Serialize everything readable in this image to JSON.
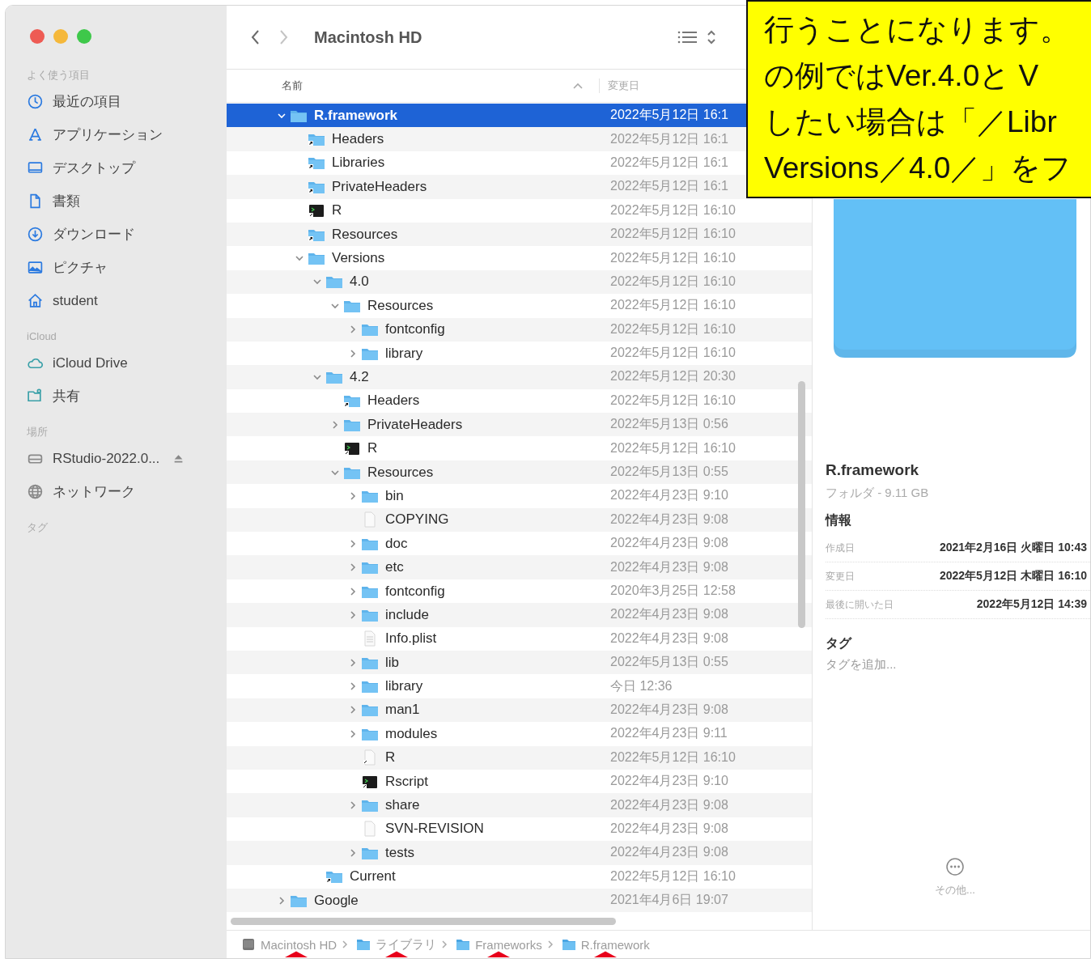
{
  "window": {
    "buttons": [
      {
        "color": "#ee5b54"
      },
      {
        "color": "#f5b83b"
      },
      {
        "color": "#3ec84a"
      }
    ]
  },
  "sidebar": {
    "sections": [
      {
        "title": "よく使う項目",
        "items": [
          {
            "label": "最近の項目",
            "kind": "recent"
          },
          {
            "label": "アプリケーション",
            "kind": "apps"
          },
          {
            "label": "デスクトップ",
            "kind": "desktop"
          },
          {
            "label": "書類",
            "kind": "documents"
          },
          {
            "label": "ダウンロード",
            "kind": "downloads"
          },
          {
            "label": "ピクチャ",
            "kind": "pictures"
          },
          {
            "label": "student",
            "kind": "home"
          }
        ]
      },
      {
        "title": "iCloud",
        "items": [
          {
            "label": "iCloud Drive",
            "kind": "cloud"
          },
          {
            "label": "共有",
            "kind": "shared"
          }
        ]
      },
      {
        "title": "場所",
        "items": [
          {
            "label": "RStudio-2022.0...",
            "kind": "volume"
          },
          {
            "label": "ネットワーク",
            "kind": "network"
          }
        ]
      },
      {
        "title": "タグ"
      }
    ]
  },
  "toolbar": {
    "nav": [
      {
        "kind": "back",
        "disabled": false
      },
      {
        "kind": "forward",
        "disabled": true
      }
    ],
    "title": "Macintosh HD"
  },
  "list": {
    "columns": [
      {
        "label": "名前",
        "sorted": true
      },
      {
        "label": "変更日",
        "sorted": false
      }
    ],
    "rows": [
      {
        "name": "R.framework",
        "date": "2022年5月12日 16:1",
        "kind": "folder",
        "expanded": true,
        "selected": true,
        "children": [
          {
            "name": "Headers",
            "date": "2022年5月12日 16:1",
            "kind": "alias",
            "selected": false
          },
          {
            "name": "Libraries",
            "date": "2022年5月12日 16:1",
            "kind": "alias",
            "selected": false
          },
          {
            "name": "PrivateHeaders",
            "date": "2022年5月12日 16:1",
            "kind": "alias",
            "selected": false
          },
          {
            "name": "R",
            "date": "2022年5月12日 16:10",
            "kind": "exec",
            "selected": false
          },
          {
            "name": "Resources",
            "date": "2022年5月12日 16:10",
            "kind": "alias",
            "selected": false
          },
          {
            "name": "Versions",
            "date": "2022年5月12日 16:10",
            "kind": "folder",
            "expanded": true,
            "selected": false,
            "children": [
              {
                "name": "4.0",
                "date": "2022年5月12日 16:10",
                "kind": "folder",
                "expanded": true,
                "selected": false,
                "children": [
                  {
                    "name": "Resources",
                    "date": "2022年5月12日 16:10",
                    "kind": "folder",
                    "expanded": true,
                    "selected": false,
                    "children": [
                      {
                        "name": "fontconfig",
                        "date": "2022年5月12日 16:10",
                        "kind": "folder",
                        "expanded": false,
                        "selected": false
                      },
                      {
                        "name": "library",
                        "date": "2022年5月12日 16:10",
                        "kind": "folder",
                        "expanded": false,
                        "selected": false
                      }
                    ]
                  }
                ]
              },
              {
                "name": "4.2",
                "date": "2022年5月12日 20:30",
                "kind": "folder",
                "expanded": true,
                "selected": false,
                "children": [
                  {
                    "name": "Headers",
                    "date": "2022年5月12日 16:10",
                    "kind": "alias",
                    "selected": false
                  },
                  {
                    "name": "PrivateHeaders",
                    "date": "2022年5月13日 0:56",
                    "kind": "folder",
                    "expanded": false,
                    "selected": false
                  },
                  {
                    "name": "R",
                    "date": "2022年5月12日 16:10",
                    "kind": "exec",
                    "selected": false
                  },
                  {
                    "name": "Resources",
                    "date": "2022年5月13日 0:55",
                    "kind": "folder",
                    "expanded": true,
                    "selected": false,
                    "children": [
                      {
                        "name": "bin",
                        "date": "2022年4月23日 9:10",
                        "kind": "folder",
                        "expanded": false,
                        "selected": false
                      },
                      {
                        "name": "COPYING",
                        "date": "2022年4月23日 9:08",
                        "kind": "doc",
                        "selected": false
                      },
                      {
                        "name": "doc",
                        "date": "2022年4月23日 9:08",
                        "kind": "folder",
                        "expanded": false,
                        "selected": false
                      },
                      {
                        "name": "etc",
                        "date": "2022年4月23日 9:08",
                        "kind": "folder",
                        "expanded": false,
                        "selected": false
                      },
                      {
                        "name": "fontconfig",
                        "date": "2020年3月25日 12:58",
                        "kind": "folder",
                        "expanded": false,
                        "selected": false
                      },
                      {
                        "name": "include",
                        "date": "2022年4月23日 9:08",
                        "kind": "folder",
                        "expanded": false,
                        "selected": false
                      },
                      {
                        "name": "Info.plist",
                        "date": "2022年4月23日 9:08",
                        "kind": "plist",
                        "selected": false
                      },
                      {
                        "name": "lib",
                        "date": "2022年5月13日 0:55",
                        "kind": "folder",
                        "expanded": false,
                        "selected": false
                      },
                      {
                        "name": "library",
                        "date": "今日 12:36",
                        "kind": "folder",
                        "expanded": false,
                        "selected": false
                      },
                      {
                        "name": "man1",
                        "date": "2022年4月23日 9:08",
                        "kind": "folder",
                        "expanded": false,
                        "selected": false
                      },
                      {
                        "name": "modules",
                        "date": "2022年4月23日 9:11",
                        "kind": "folder",
                        "expanded": false,
                        "selected": false
                      },
                      {
                        "name": "R",
                        "date": "2022年5月12日 16:10",
                        "kind": "aliasfile",
                        "selected": false
                      },
                      {
                        "name": "Rscript",
                        "date": "2022年4月23日 9:10",
                        "kind": "exec",
                        "selected": false
                      },
                      {
                        "name": "share",
                        "date": "2022年4月23日 9:08",
                        "kind": "folder",
                        "expanded": false,
                        "selected": false
                      },
                      {
                        "name": "SVN-REVISION",
                        "date": "2022年4月23日 9:08",
                        "kind": "doc",
                        "selected": false
                      },
                      {
                        "name": "tests",
                        "date": "2022年4月23日 9:08",
                        "kind": "folder",
                        "expanded": false,
                        "selected": false
                      }
                    ]
                  }
                ]
              },
              {
                "name": "Current",
                "date": "2022年5月12日 16:10",
                "kind": "alias",
                "selected": false
              }
            ]
          }
        ]
      },
      {
        "name": "Google",
        "date": "2021年4月6日 19:07",
        "kind": "folder",
        "expanded": false,
        "selected": false
      }
    ]
  },
  "info": {
    "name": "R.framework",
    "subtitle": "フォルダ - 9.11 GB",
    "section": "情報",
    "fields": [
      {
        "label": "作成日",
        "value": "2021年2月16日 火曜日 10:43"
      },
      {
        "label": "変更日",
        "value": "2022年5月12日 木曜日 16:10"
      },
      {
        "label": "最後に開いた日",
        "value": "2022年5月12日 14:39"
      }
    ],
    "tags_title": "タグ",
    "tags_placeholder": "タグを追加...",
    "more": "その他..."
  },
  "path_bar": [
    {
      "label": "Macintosh HD",
      "kind": "disk"
    },
    {
      "label": "ライブラリ",
      "kind": "folder"
    },
    {
      "label": "Frameworks",
      "kind": "folder"
    },
    {
      "label": "R.framework",
      "kind": "folder"
    }
  ],
  "callout": {
    "lines": [
      "行うことになります。",
      "の例ではVer.4.0と V",
      "したい場合は「／Libr",
      "Versions／4.0／」をフ"
    ]
  }
}
